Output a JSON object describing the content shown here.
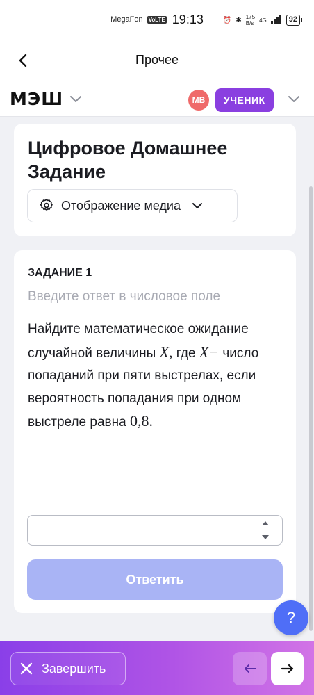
{
  "status_bar": {
    "carrier": "MegaFon",
    "volte": "VoLTE",
    "time": "19:13",
    "net_speed_value": "175",
    "net_speed_unit": "B/s",
    "network": "4G",
    "battery": "92"
  },
  "header": {
    "title": "Прочее"
  },
  "appbar": {
    "logo": "МЭШ",
    "avatar_initials": "МВ",
    "role": "УЧЕНИК"
  },
  "page": {
    "title": "Цифровое Домашнее Задание",
    "media_button_label": "Отображение медиа"
  },
  "task": {
    "label": "ЗАДАНИЕ 1",
    "hint": "Введите ответ в числовое поле",
    "text_part1": "Найдите математическое ожидание случайной величины ",
    "math_x1": "X,",
    "text_part2": " где ",
    "math_x2": "X−",
    "text_part3": " число попаданий при пяти выстрелах, если вероятность попадания при одном выстреле равна ",
    "math_p": "0,8.",
    "answer_value": "",
    "submit_label": "Ответить"
  },
  "bottom_bar": {
    "finish_label": "Завершить"
  },
  "help_label": "?",
  "colors": {
    "accent_purple": "#8a3fe0",
    "submit_disabled": "#a9b4f5",
    "help_blue": "#4f6ef7",
    "avatar_red": "#ef6a6a"
  }
}
